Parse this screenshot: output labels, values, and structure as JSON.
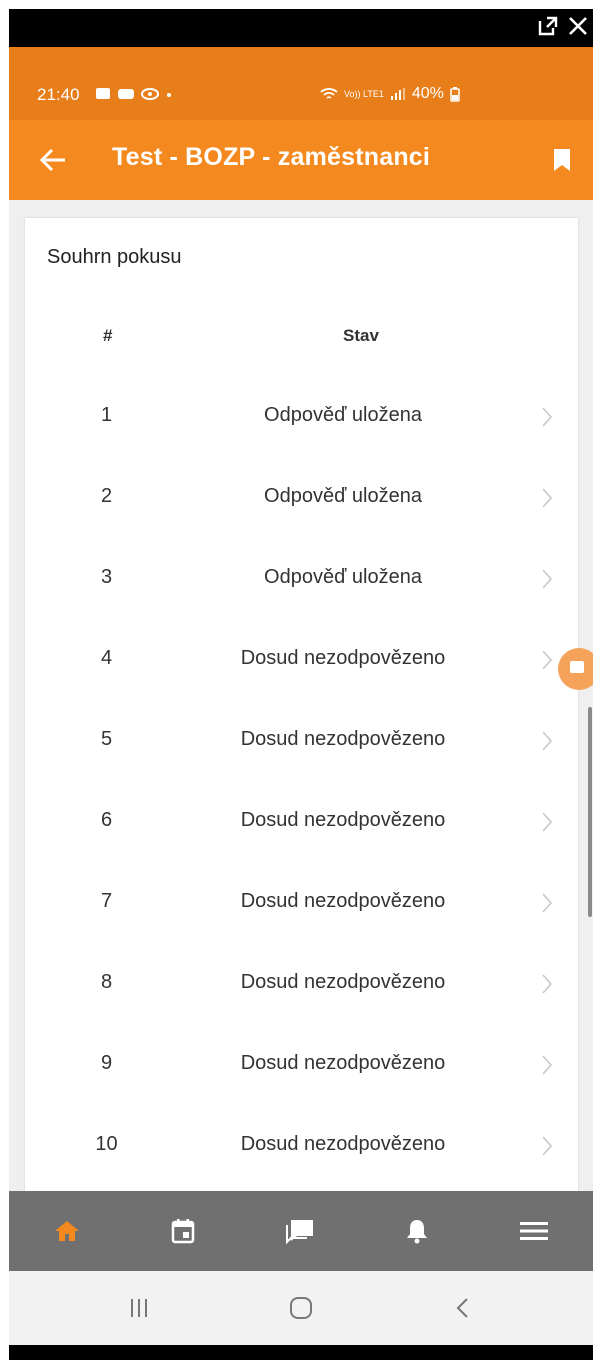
{
  "status_bar": {
    "time": "21:40",
    "battery": "40%",
    "network": "Vo)) LTE1"
  },
  "app_bar": {
    "title": "Test - BOZP - zaměstnanci",
    "back_icon": "arrow-back-icon",
    "bookmark_icon": "bookmark-icon"
  },
  "summary": {
    "title": "Souhrn pokusu",
    "headers": {
      "number": "#",
      "state": "Stav"
    },
    "rows": [
      {
        "number": "1",
        "state": "Odpověď uložena"
      },
      {
        "number": "2",
        "state": "Odpověď uložena"
      },
      {
        "number": "3",
        "state": "Odpověď uložena"
      },
      {
        "number": "4",
        "state": "Dosud nezodpovězeno"
      },
      {
        "number": "5",
        "state": "Dosud nezodpovězeno"
      },
      {
        "number": "6",
        "state": "Dosud nezodpovězeno"
      },
      {
        "number": "7",
        "state": "Dosud nezodpovězeno"
      },
      {
        "number": "8",
        "state": "Dosud nezodpovězeno"
      },
      {
        "number": "9",
        "state": "Dosud nezodpovězeno"
      },
      {
        "number": "10",
        "state": "Dosud nezodpovězeno"
      }
    ]
  },
  "bottom_nav": [
    "home-icon",
    "calendar-icon",
    "messages-icon",
    "notifications-icon",
    "menu-icon"
  ],
  "system_nav": [
    "recents-icon",
    "home-circle-icon",
    "back-chevron-icon"
  ],
  "colors": {
    "accent": "#f48a1f",
    "status_bar": "#e77e1a",
    "nav_bar": "#707070",
    "nav_active": "#f48a1f"
  }
}
